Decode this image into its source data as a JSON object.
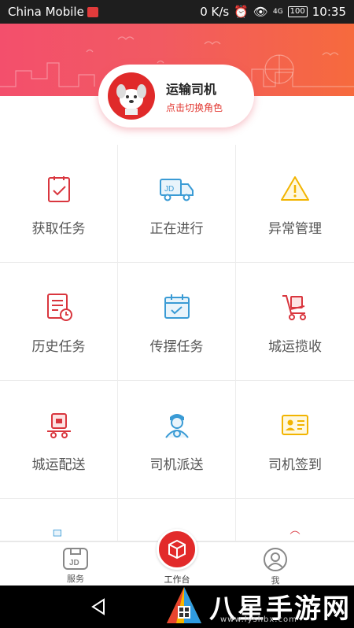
{
  "status_bar": {
    "carrier": "China Mobile",
    "speed": "0 K/s",
    "network": "4G",
    "battery": "100",
    "time": "10:35"
  },
  "role": {
    "title": "运输司机",
    "switch_label": "点击切换角色"
  },
  "grid": [
    {
      "label": "获取任务",
      "icon": "clipboard-check-icon"
    },
    {
      "label": "正在进行",
      "icon": "jd-truck-icon"
    },
    {
      "label": "异常管理",
      "icon": "warning-triangle-icon"
    },
    {
      "label": "历史任务",
      "icon": "history-document-icon"
    },
    {
      "label": "传摆任务",
      "icon": "calendar-check-icon"
    },
    {
      "label": "城运揽收",
      "icon": "hand-cart-icon"
    },
    {
      "label": "城运配送",
      "icon": "delivery-cart-icon"
    },
    {
      "label": "司机派送",
      "icon": "driver-avatar-icon"
    },
    {
      "label": "司机签到",
      "icon": "id-card-icon"
    }
  ],
  "nav": {
    "left_label": "服务",
    "center_label": "工作台",
    "right_label": "我"
  },
  "watermark": {
    "text": "八星手游网",
    "url": "www.lyshbx.com"
  },
  "colors": {
    "brand_red": "#e22a2a",
    "header_start": "#f34f6c",
    "header_end": "#f66a3d",
    "icon_blue": "#3a9bd5",
    "icon_yellow": "#f2b400"
  }
}
